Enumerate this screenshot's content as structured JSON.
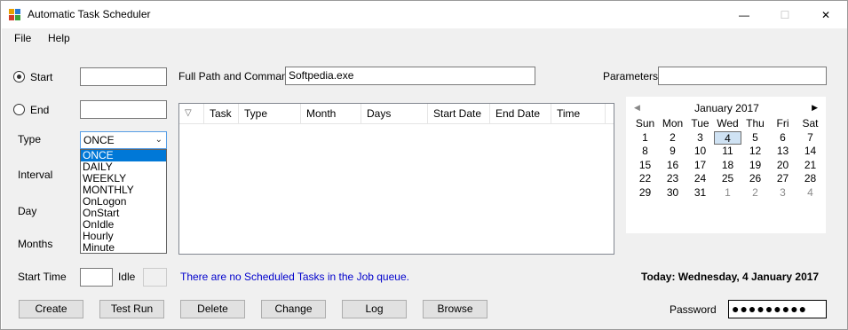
{
  "window": {
    "title": "Automatic Task Scheduler",
    "min_glyph": "—",
    "max_glyph": "☐",
    "close_glyph": "✕"
  },
  "menu": {
    "file": "File",
    "help": "Help"
  },
  "form": {
    "start_label": "Start",
    "end_label": "End",
    "type_label": "Type",
    "interval_label": "Interval",
    "day_label": "Day",
    "months_label": "Months",
    "start_time_label": "Start Time",
    "idle_label": "Idle",
    "path_label": "Full Path and Command",
    "path_value": "Softpedia.exe",
    "params_label": "Parameters",
    "params_value": "",
    "start_value": "",
    "end_value": "",
    "start_time_value": "",
    "type_selected": "ONCE",
    "type_options": [
      "ONCE",
      "DAILY",
      "WEEKLY",
      "MONTHLY",
      "OnLogon",
      "OnStart",
      "OnIdle",
      "Hourly",
      "Minute"
    ]
  },
  "grid": {
    "sort_glyph": "▽",
    "columns": [
      "Task",
      "Type",
      "Month",
      "Days",
      "Start Date",
      "End Date",
      "Time"
    ]
  },
  "calendar": {
    "month_label": "January 2017",
    "prev_glyph": "◀",
    "next_glyph": "▶",
    "days_of_week": [
      "Sun",
      "Mon",
      "Tue",
      "Wed",
      "Thu",
      "Fri",
      "Sat"
    ],
    "weeks": [
      [
        {
          "d": "1",
          "o": false
        },
        {
          "d": "2",
          "o": false
        },
        {
          "d": "3",
          "o": false
        },
        {
          "d": "4",
          "o": false,
          "today": true
        },
        {
          "d": "5",
          "o": false
        },
        {
          "d": "6",
          "o": false
        },
        {
          "d": "7",
          "o": false
        }
      ],
      [
        {
          "d": "8",
          "o": false
        },
        {
          "d": "9",
          "o": false
        },
        {
          "d": "10",
          "o": false
        },
        {
          "d": "11",
          "o": false
        },
        {
          "d": "12",
          "o": false
        },
        {
          "d": "13",
          "o": false
        },
        {
          "d": "14",
          "o": false
        }
      ],
      [
        {
          "d": "15",
          "o": false
        },
        {
          "d": "16",
          "o": false
        },
        {
          "d": "17",
          "o": false
        },
        {
          "d": "18",
          "o": false
        },
        {
          "d": "19",
          "o": false
        },
        {
          "d": "20",
          "o": false
        },
        {
          "d": "21",
          "o": false
        }
      ],
      [
        {
          "d": "22",
          "o": false
        },
        {
          "d": "23",
          "o": false
        },
        {
          "d": "24",
          "o": false
        },
        {
          "d": "25",
          "o": false
        },
        {
          "d": "26",
          "o": false
        },
        {
          "d": "27",
          "o": false
        },
        {
          "d": "28",
          "o": false
        }
      ],
      [
        {
          "d": "29",
          "o": false
        },
        {
          "d": "30",
          "o": false
        },
        {
          "d": "31",
          "o": false
        },
        {
          "d": "1",
          "o": true
        },
        {
          "d": "2",
          "o": true
        },
        {
          "d": "3",
          "o": true
        },
        {
          "d": "4",
          "o": true
        }
      ]
    ]
  },
  "status": {
    "message": "There are no Scheduled Tasks in the Job queue.",
    "today": "Today: Wednesday, 4 January 2017"
  },
  "buttons": {
    "create": "Create",
    "test_run": "Test Run",
    "delete": "Delete",
    "change": "Change",
    "log": "Log",
    "browse": "Browse"
  },
  "password": {
    "label": "Password",
    "masked": "●●●●●●●●●"
  },
  "colors": {
    "status_text": "#0000cc",
    "selection": "#0078d7",
    "today_highlight": "#cfe2f3"
  }
}
